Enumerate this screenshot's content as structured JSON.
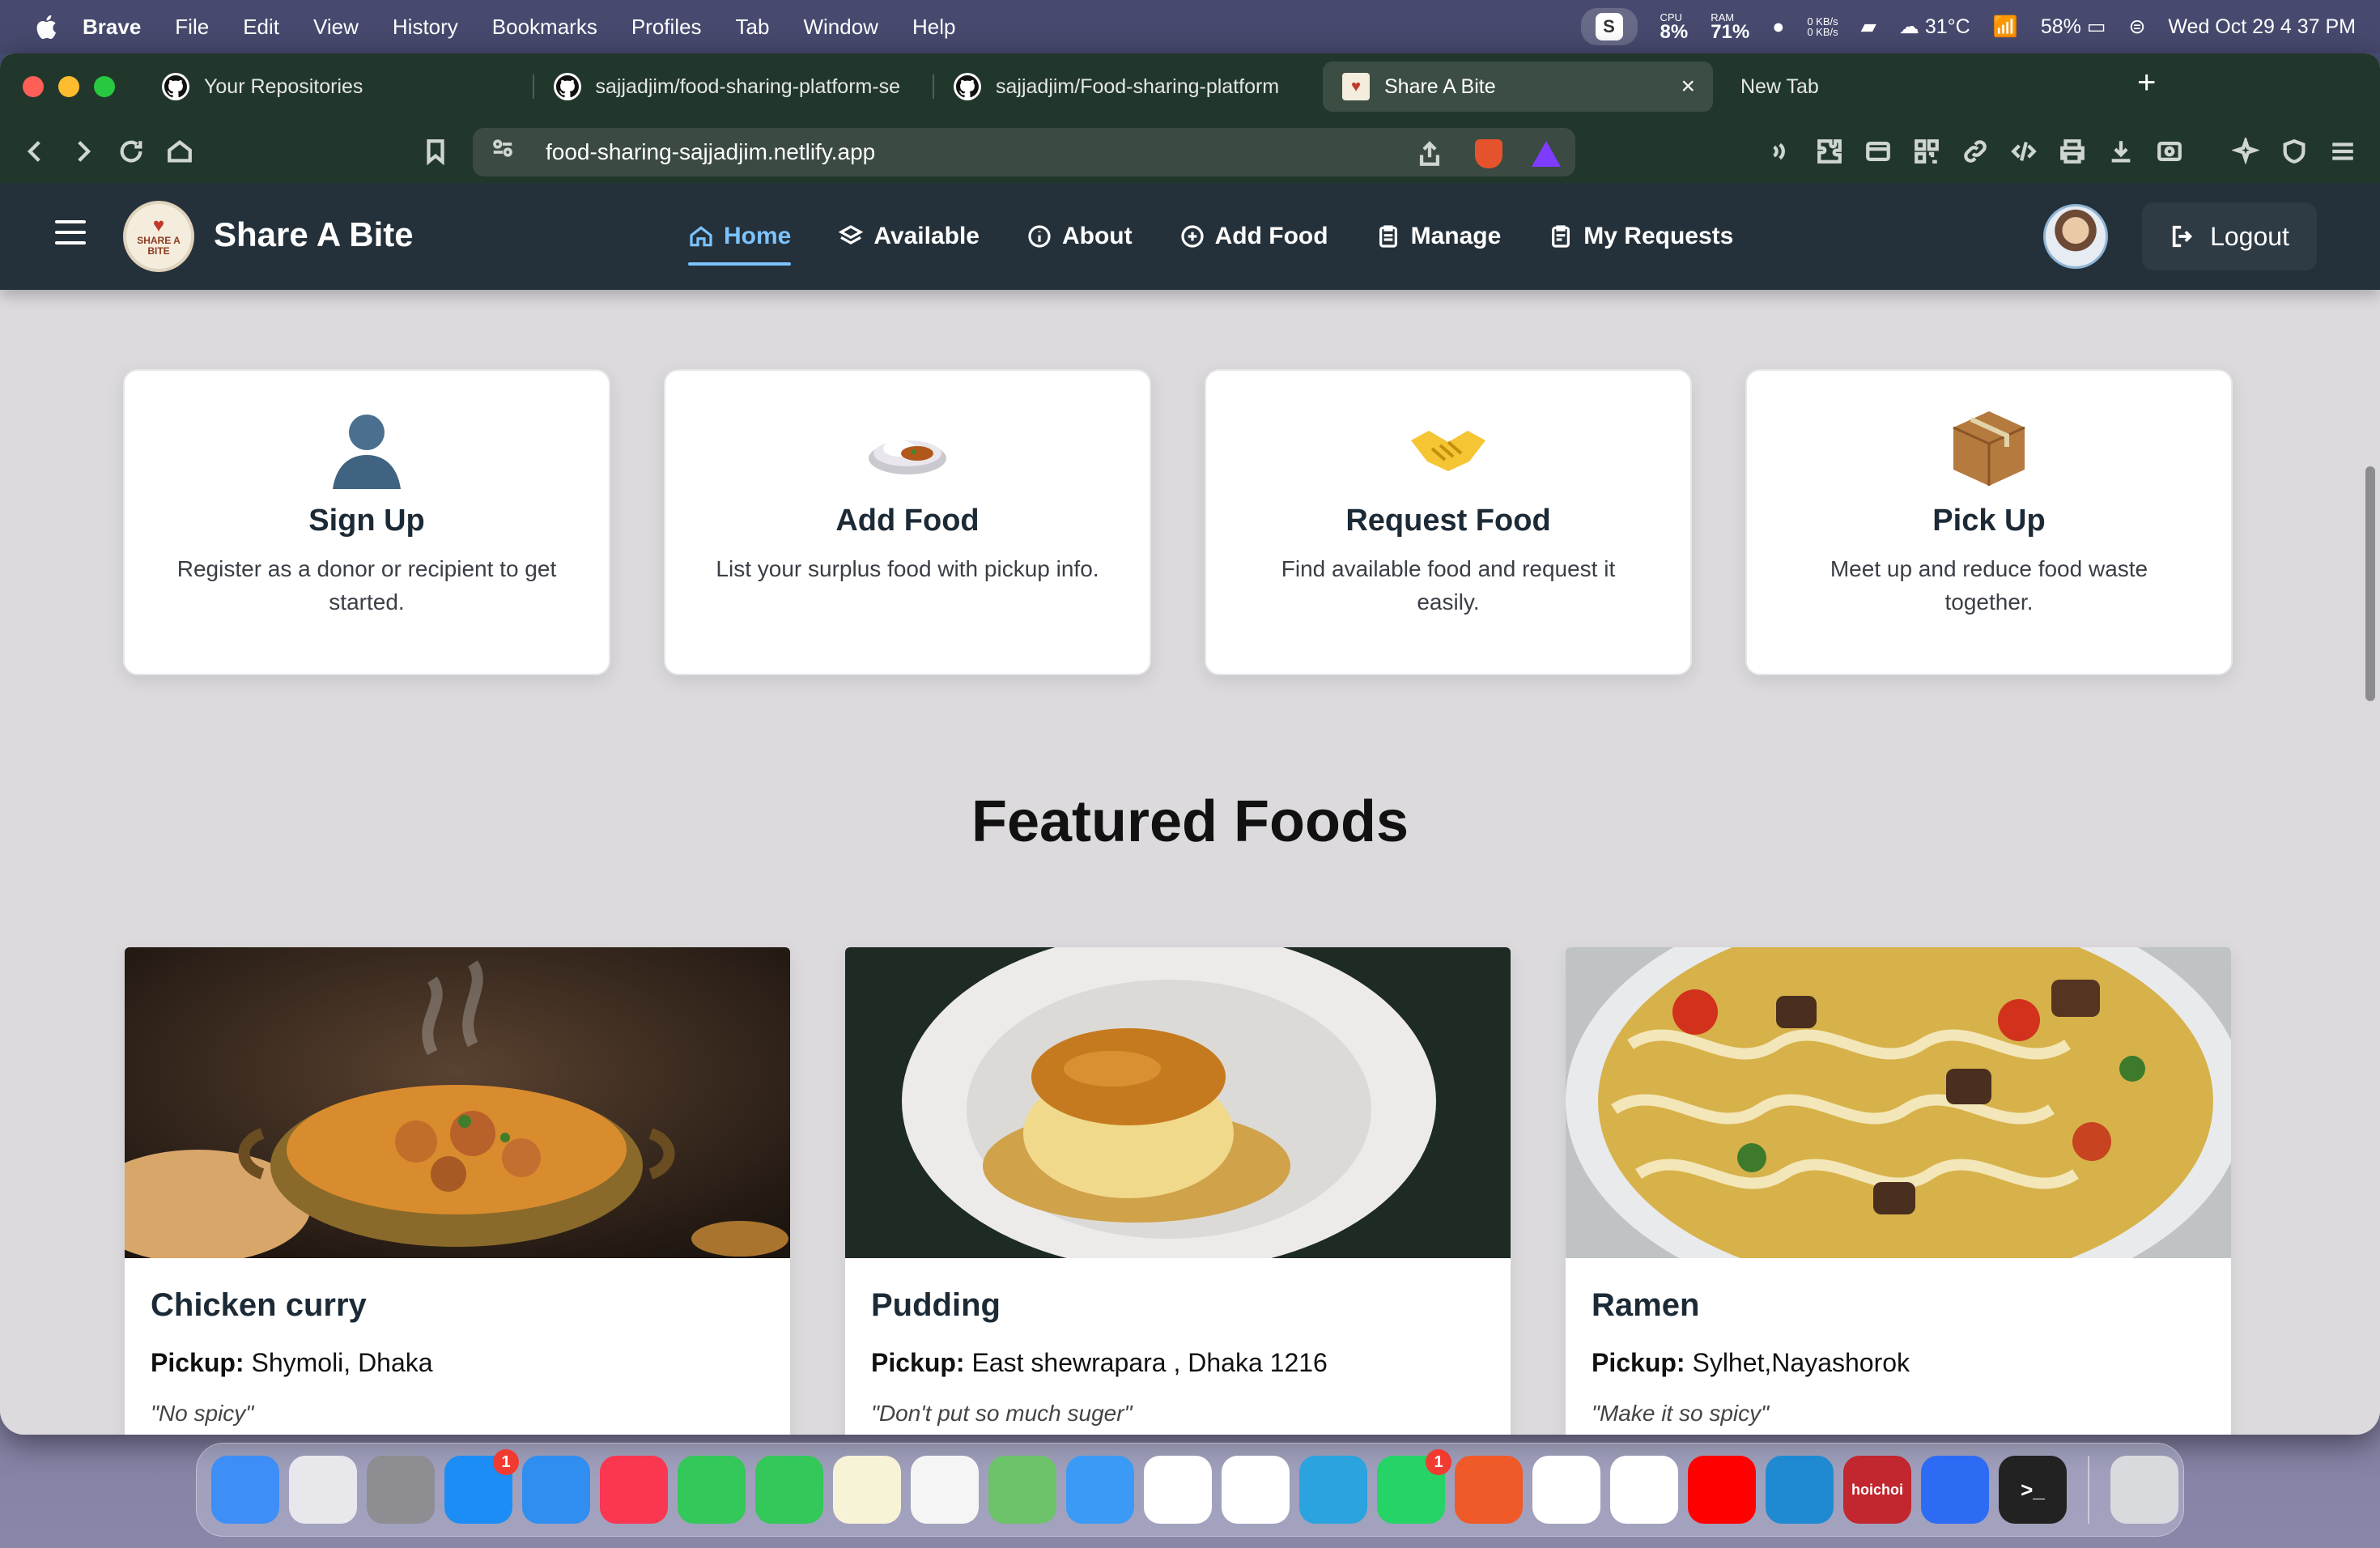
{
  "os": {
    "app_name": "Brave",
    "menus": [
      "File",
      "Edit",
      "View",
      "History",
      "Bookmarks",
      "Profiles",
      "Tab",
      "Window",
      "Help"
    ],
    "status": {
      "s_icon": "S",
      "cpu_label": "CPU",
      "cpu_value": "8%",
      "ram_label": "RAM",
      "ram_value": "71%",
      "net_up": "0 KB/s",
      "net_down": "0 KB/s",
      "temperature": "31°C",
      "battery": "58%",
      "datetime": "Wed Oct 29  4 37 PM"
    }
  },
  "browser": {
    "tabs": [
      {
        "label": "Your Repositories",
        "icon": "github-icon"
      },
      {
        "label": "sajjadjim/food-sharing-platform-se",
        "icon": "github-icon"
      },
      {
        "label": "sajjadjim/Food-sharing-platform",
        "icon": "github-icon"
      },
      {
        "label": "Share A Bite",
        "icon": "site-favicon",
        "active": true
      },
      {
        "label": "New Tab",
        "icon": ""
      }
    ],
    "tab_close": "×",
    "new_tab": "+",
    "url": "food-sharing-sajjadjim.netlify.app"
  },
  "site": {
    "logo_text": "SHARE A BITE",
    "brand": "Share A Bite",
    "nav": [
      {
        "label": "Home",
        "icon": "home-icon",
        "active": true
      },
      {
        "label": "Available",
        "icon": "layers-icon"
      },
      {
        "label": "About",
        "icon": "info-icon"
      },
      {
        "label": "Add Food",
        "icon": "plus-circle-icon"
      },
      {
        "label": "Manage",
        "icon": "clipboard-icon"
      },
      {
        "label": "My Requests",
        "icon": "clipboard-list-icon"
      }
    ],
    "logout": "Logout",
    "steps": [
      {
        "icon": "👤",
        "title": "Sign Up",
        "text": "Register as a donor or recipient to get started."
      },
      {
        "icon": "🍛",
        "title": "Add Food",
        "text": "List your surplus food with pickup info."
      },
      {
        "icon": "🤝",
        "title": "Request Food",
        "text": "Find available food and request it easily."
      },
      {
        "icon": "📦",
        "title": "Pick Up",
        "text": "Meet up and reduce food waste together."
      }
    ],
    "featured_heading": "Featured Foods",
    "pickup_label": "Pickup:",
    "foods": [
      {
        "name": "Chicken curry",
        "pickup": "Shymoli, Dhaka",
        "note": "\"No spicy\""
      },
      {
        "name": "Pudding",
        "pickup": "East shewrapara , Dhaka 1216",
        "note": "\"Don't put so much suger\""
      },
      {
        "name": "Ramen",
        "pickup": "Sylhet,Nayashorok",
        "note": "\"Make it so spicy\""
      }
    ]
  },
  "dock": {
    "apps": [
      {
        "name": "finder",
        "color": "#3d8ef7"
      },
      {
        "name": "launchpad",
        "color": "#e8e8ec"
      },
      {
        "name": "system-settings",
        "color": "#8d8d92"
      },
      {
        "name": "app-store",
        "color": "#1c8df5",
        "badge": "1"
      },
      {
        "name": "safari",
        "color": "#2f8ef0"
      },
      {
        "name": "music",
        "color": "#fa3650"
      },
      {
        "name": "phone",
        "color": "#34c759"
      },
      {
        "name": "messages",
        "color": "#34c759"
      },
      {
        "name": "notes",
        "color": "#f7f3d6"
      },
      {
        "name": "reminders",
        "color": "#f5f5f5"
      },
      {
        "name": "maps",
        "color": "#6cc36a"
      },
      {
        "name": "weather",
        "color": "#3a9af5"
      },
      {
        "name": "gmail",
        "color": "#ffffff"
      },
      {
        "name": "photos",
        "color": "#ffffff"
      },
      {
        "name": "telegram",
        "color": "#2aa3df"
      },
      {
        "name": "whatsapp",
        "color": "#25d366",
        "badge": "1"
      },
      {
        "name": "brave",
        "color": "#f05a28"
      },
      {
        "name": "chatgpt",
        "color": "#ffffff"
      },
      {
        "name": "chrome",
        "color": "#ffffff"
      },
      {
        "name": "youtube",
        "color": "#ff0000"
      },
      {
        "name": "vscode",
        "color": "#1f8ad2"
      },
      {
        "name": "hoichoi",
        "color": "#c2262e",
        "label": "hoichoi"
      },
      {
        "name": "messenger",
        "color": "#2d6bf4"
      },
      {
        "name": "terminal",
        "color": "#222222",
        "label": ">_"
      },
      {
        "name": "trash",
        "color": "#d8dade"
      }
    ]
  }
}
